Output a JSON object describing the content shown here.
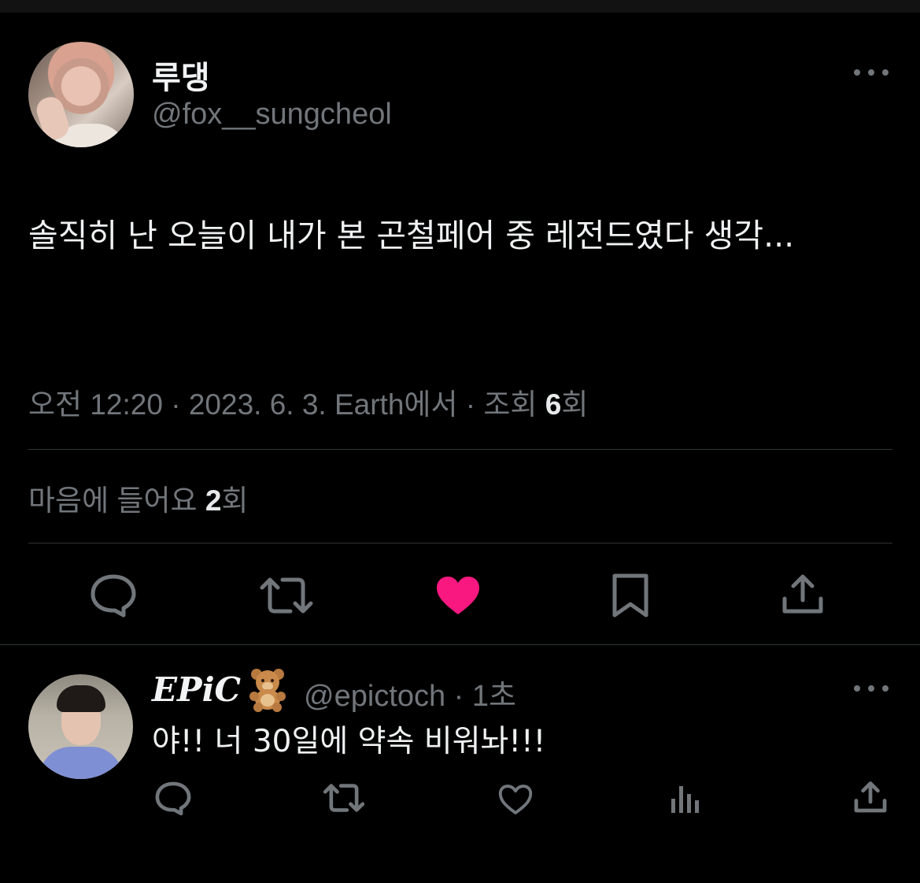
{
  "main_tweet": {
    "display_name": "루댕",
    "handle": "@fox__sungcheol",
    "text": "솔직히 난 오늘이 내가 본 곤철페어 중 레전드였다 생각...",
    "meta_prefix": "오전 12:20 · 2023. 6. 3. Earth에서 · 조회 ",
    "views": "6",
    "views_suffix": "회",
    "likes_label": "마음에 들어요 ",
    "likes": "2",
    "likes_suffix": "회",
    "liked": true,
    "colors": {
      "like_active": "#f91880",
      "muted": "#71767b"
    }
  },
  "reply": {
    "display_name": "EPiC",
    "emoji": "teddy-bear-emoji",
    "handle_time": "@epictoch · 1초",
    "text": "야!! 너 30일에 약속 비워놔!!!"
  }
}
